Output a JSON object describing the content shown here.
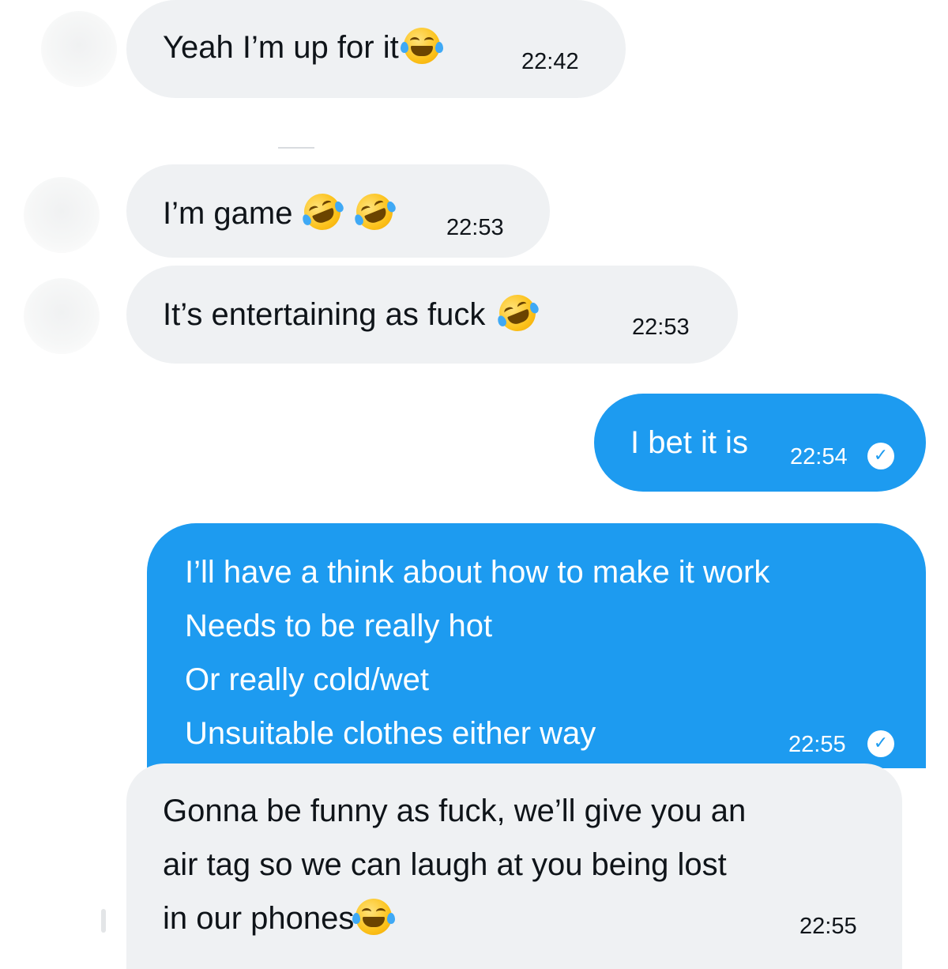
{
  "conversation": {
    "messages": [
      {
        "direction": "incoming",
        "lines": [
          "Yeah I’m up for it"
        ],
        "emojis": [
          "face-with-tears-of-joy"
        ],
        "time": "22:42"
      },
      {
        "direction": "incoming",
        "lines": [
          "I’m game"
        ],
        "emojis": [
          "rolling-on-floor-laughing",
          "rolling-on-floor-laughing"
        ],
        "time": "22:53"
      },
      {
        "direction": "incoming",
        "lines": [
          "It’s entertaining as fuck"
        ],
        "emojis": [
          "rolling-on-floor-laughing"
        ],
        "time": "22:53"
      },
      {
        "direction": "outgoing",
        "lines": [
          "I bet it is"
        ],
        "time": "22:54",
        "status": "read-check-icon"
      },
      {
        "direction": "outgoing",
        "lines": [
          "I’ll have a think about how to make it work",
          "Needs to be really hot",
          "Or really cold/wet",
          "Unsuitable clothes either way"
        ],
        "time": "22:55",
        "status": "read-check-icon"
      },
      {
        "direction": "incoming",
        "lines": [
          "Gonna be funny as fuck, we’ll give you an",
          "air tag so we can laugh at you being lost",
          "in our phones"
        ],
        "emojis": [
          "face-with-tears-of-joy"
        ],
        "time": "22:55"
      }
    ]
  },
  "colors": {
    "incoming_bubble": "#eff1f3",
    "outgoing_bubble": "#1d9bf0",
    "incoming_text": "#0f1419",
    "outgoing_text": "#ffffff"
  }
}
